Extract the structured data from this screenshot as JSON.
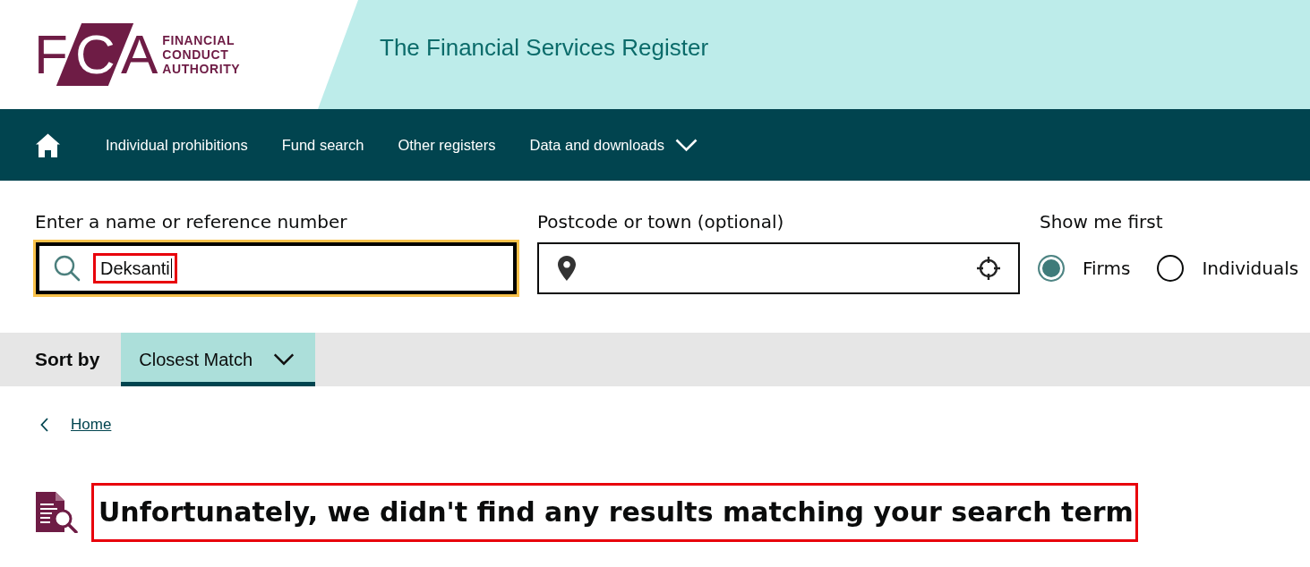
{
  "header": {
    "logo": {
      "letters": "FCA",
      "lines": [
        "FINANCIAL",
        "CONDUCT",
        "AUTHORITY"
      ]
    },
    "title": "The Financial Services Register"
  },
  "nav": {
    "items": [
      {
        "label": "Individual prohibitions",
        "kind": "link"
      },
      {
        "label": "Fund search",
        "kind": "link"
      },
      {
        "label": "Other registers",
        "kind": "link"
      },
      {
        "label": "Data and downloads",
        "kind": "dropdown"
      }
    ]
  },
  "search": {
    "name_field": {
      "label": "Enter a name or reference number",
      "value": "Deksanti",
      "focused": true,
      "highlighted": true
    },
    "location_field": {
      "label": "Postcode or town (optional)"
    },
    "show_me_first": {
      "label": "Show me first",
      "options": [
        {
          "label": "Firms",
          "selected": true
        },
        {
          "label": "Individuals",
          "selected": false
        }
      ]
    }
  },
  "sort": {
    "label": "Sort by",
    "value": "Closest Match"
  },
  "breadcrumb": [
    {
      "label": "Home"
    }
  ],
  "result": {
    "message": "Unfortunately, we didn't find any results matching your search term",
    "highlighted": true
  }
}
